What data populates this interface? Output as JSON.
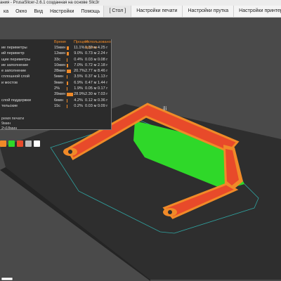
{
  "window": {
    "title": "ания - PrusaSlicer-2.6.1 созданная на основе Slic3r"
  },
  "menu": [
    "ка",
    "Окно",
    "Вид",
    "Настройки",
    "Помощь"
  ],
  "tabs": [
    "[ Стол ]",
    "Настройки печати",
    "Настройки прутка",
    "Настройки принтера"
  ],
  "stats": {
    "headers": {
      "time": "Время",
      "percent": "Процент",
      "used": "Использовано прутка"
    },
    "rows": [
      {
        "name": "ие периметры",
        "time": "15мин",
        "pct": "11.1%",
        "used": "1.39 м  4.25 г",
        "frac": 0.111
      },
      {
        "name": "ий периметр",
        "time": "12мин",
        "pct": "9.0%",
        "used": "0.73 м  2.24 г",
        "frac": 0.09
      },
      {
        "name": "щие периметры",
        "time": "33с",
        "pct": "0.4%",
        "used": "0.03 м  0.08 г",
        "frac": 0.004
      },
      {
        "name": "ие заполнение",
        "time": "10мин",
        "pct": "7.0%",
        "used": "0.72 м  2.18 г",
        "frac": 0.07
      },
      {
        "name": "е заполнение",
        "time": "28мин",
        "pct": "20.7%",
        "used": "2.77 м  8.46 г",
        "frac": 0.207
      },
      {
        "name": "сплошной слой",
        "time": "5мин",
        "pct": "3.5%",
        "used": "0.37 м  1.13 г",
        "frac": 0.035
      },
      {
        "name": "и мостов",
        "time": "9мин",
        "pct": "6.9%",
        "used": "0.47 м  1.44 г",
        "frac": 0.069
      },
      {
        "name": "",
        "time": "2%",
        "pct": "1.9%",
        "used": "0.05 м  0.17 г",
        "frac": 0.019
      },
      {
        "name": "",
        "time": "39мин",
        "pct": "28.9%",
        "used": "2.30 м  7.03 г",
        "frac": 0.289
      },
      {
        "name": "слой поддержки",
        "time": "6мин",
        "pct": "4.2%",
        "used": "0.12 м  0.36 г",
        "frac": 0.042
      },
      {
        "name": "тельские",
        "time": "15с",
        "pct": "0.2%",
        "used": "0.03 м  0.09 г",
        "frac": 0.002
      }
    ],
    "footer_label": "ремя печати",
    "summary_1": "9мин",
    "summary_2": "2ч18мин"
  },
  "plate": {
    "label": "ili"
  },
  "colors": {
    "background": "#4a4a4a",
    "bed": "#2e2e2e",
    "perimeter": "#f08a28",
    "outer_perimeter": "#e84a2a",
    "infill": "#2fd829",
    "accent": "#f08a28"
  },
  "icons": [
    "perimeter-color-icon",
    "infill-color-icon",
    "support-color-icon",
    "retract-icon",
    "cube-icon"
  ]
}
